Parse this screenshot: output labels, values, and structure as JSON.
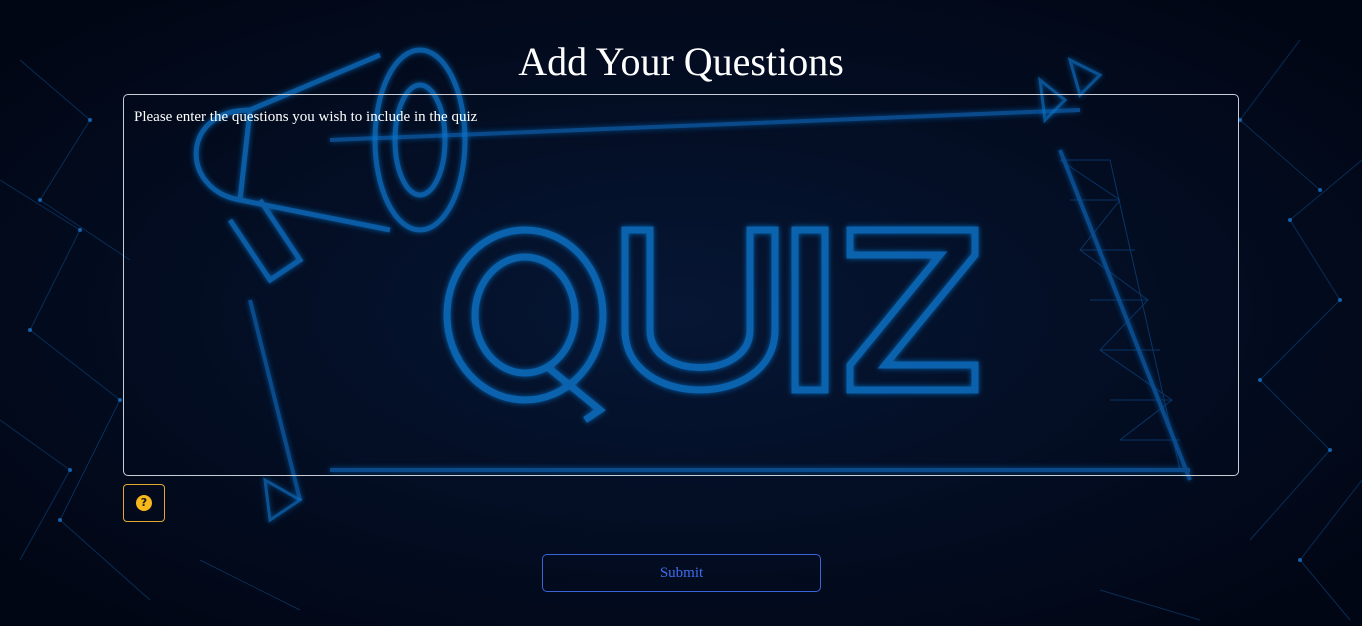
{
  "page": {
    "title": "Add Your Questions"
  },
  "questions": {
    "placeholder": "Please enter the questions you wish to include in the quiz",
    "value": ""
  },
  "help": {
    "icon": "question-circle-icon",
    "glyph": "?"
  },
  "submit": {
    "label": "Submit"
  },
  "background": {
    "word": "QUIZ",
    "color": "#0d6fc4"
  }
}
